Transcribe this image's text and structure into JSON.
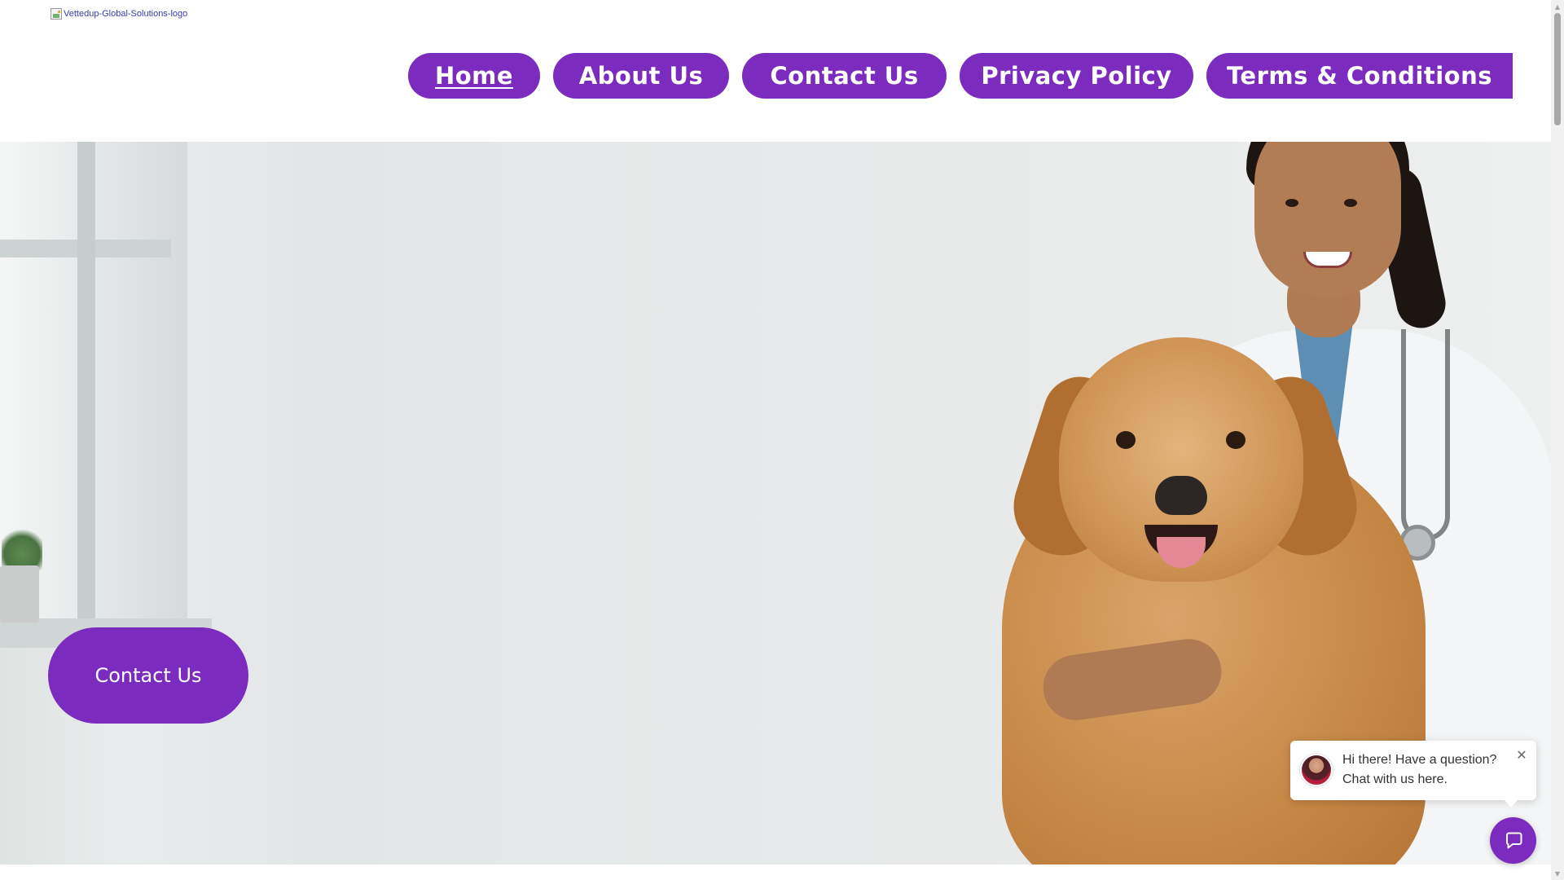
{
  "header": {
    "logo_alt": "Vettedup-Global-Solutions-logo"
  },
  "nav": {
    "items": [
      {
        "label": "Home",
        "active": true
      },
      {
        "label": "About Us"
      },
      {
        "label": "Contact Us"
      },
      {
        "label": "Privacy Policy"
      },
      {
        "label": "Terms & Conditions"
      }
    ]
  },
  "hero": {
    "cta_label": "Contact Us"
  },
  "chat": {
    "message_line1": "Hi there! Have a question?",
    "message_line2": "Chat with us here.",
    "close_glyph": "✕",
    "launcher_icon": "chat-icon"
  },
  "scrollbar": {
    "up_glyph": "▲",
    "down_glyph": "▼"
  },
  "colors": {
    "accent": "#7b2cbf",
    "text_on_accent": "#ffffff"
  }
}
